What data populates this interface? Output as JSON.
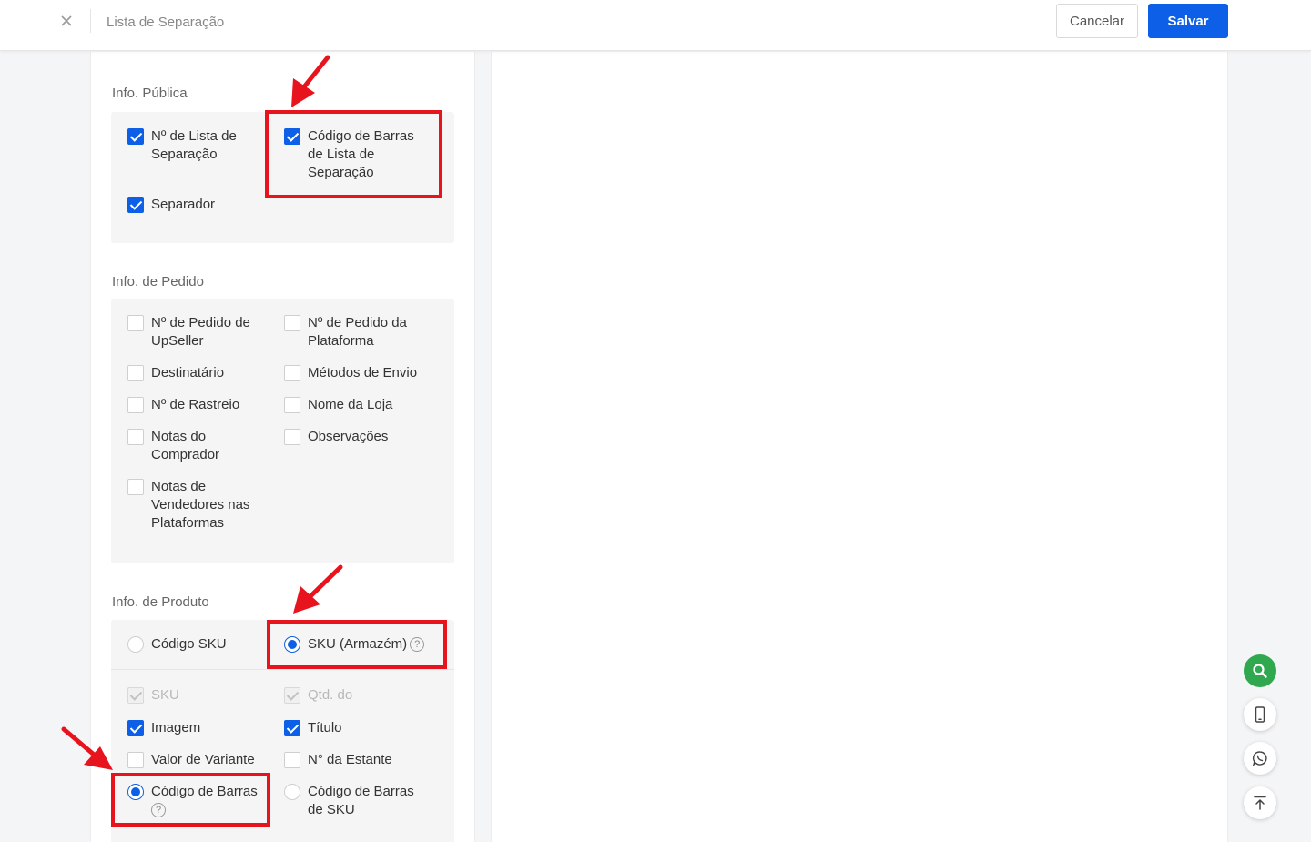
{
  "header": {
    "title": "Lista de Separação",
    "cancel_label": "Cancelar",
    "save_label": "Salvar"
  },
  "sections": {
    "publica": {
      "title": "Info. Pública",
      "items": [
        {
          "label": "Nº de Lista de Separação",
          "checked": true
        },
        {
          "label": "Código de Barras de Lista de Separação",
          "checked": true
        },
        {
          "label": "Separador",
          "checked": true
        }
      ]
    },
    "pedido": {
      "title": "Info. de Pedido",
      "items": [
        {
          "label": "Nº de Pedido de UpSeller",
          "checked": false
        },
        {
          "label": "Nº de Pedido da Plataforma",
          "checked": false
        },
        {
          "label": "Destinatário",
          "checked": false
        },
        {
          "label": "Métodos de Envio",
          "checked": false
        },
        {
          "label": "Nº de Rastreio",
          "checked": false
        },
        {
          "label": "Nome da Loja",
          "checked": false
        },
        {
          "label": "Notas do Comprador",
          "checked": false
        },
        {
          "label": "Observações",
          "checked": false
        },
        {
          "label": "Notas de Vendedores nas Plataformas",
          "checked": false
        }
      ]
    },
    "produto": {
      "title": "Info. de Produto",
      "radios": [
        {
          "label": "Código SKU",
          "checked": false
        },
        {
          "label": "SKU (Armazém)",
          "checked": true
        }
      ],
      "items": [
        {
          "label": "SKU",
          "checked": true,
          "disabled": true
        },
        {
          "label": "Qtd. do",
          "checked": true,
          "disabled": true
        },
        {
          "label": "Imagem",
          "checked": true
        },
        {
          "label": "Título",
          "checked": true
        },
        {
          "label": "Valor de Variante",
          "checked": false
        },
        {
          "label": "N° da Estante",
          "checked": false
        }
      ],
      "barcode_radios": [
        {
          "label": "Código de Barras",
          "checked": true
        },
        {
          "label": "Código de Barras de SKU",
          "checked": false
        }
      ]
    }
  },
  "help_glyph": "?",
  "colors": {
    "primary": "#0c5fe6",
    "highlight": "#e8141d",
    "fab_green": "#2fa84f"
  },
  "floating_buttons": [
    "search-icon",
    "mobile-icon",
    "whatsapp-icon",
    "back-to-top-icon"
  ]
}
